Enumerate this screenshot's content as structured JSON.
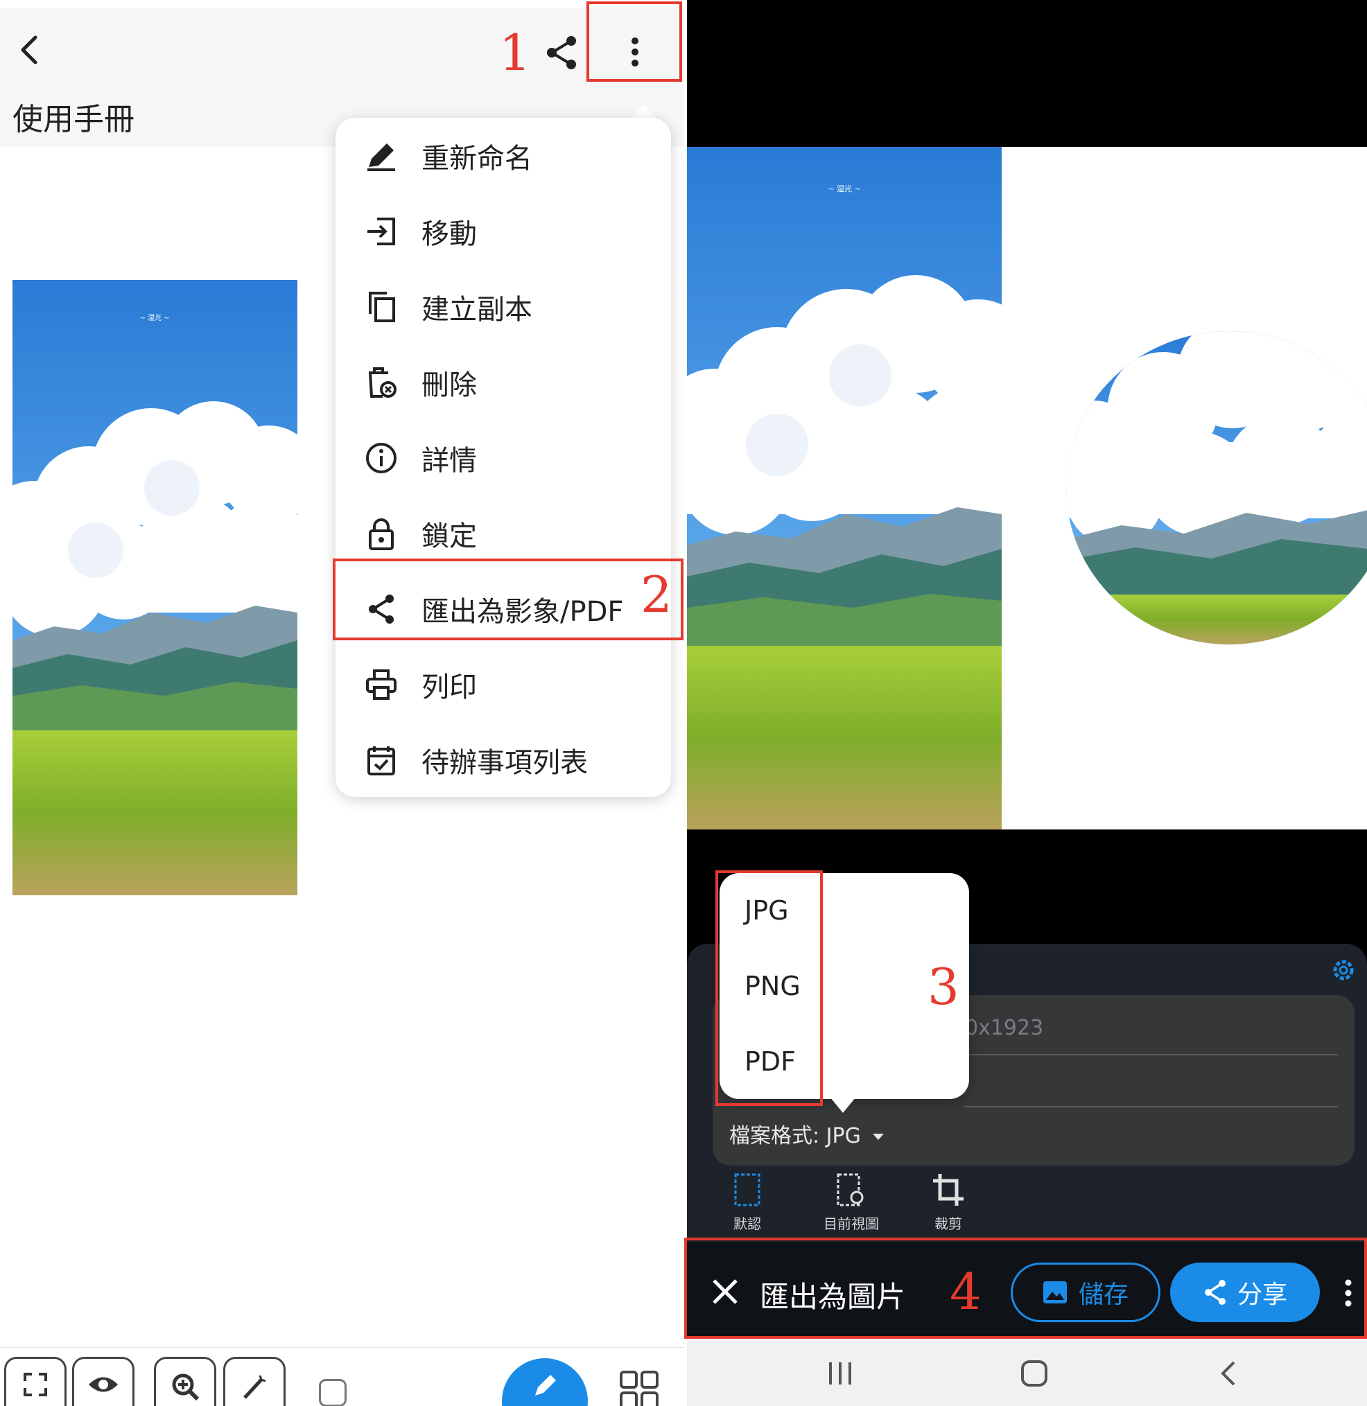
{
  "left_screen": {
    "doc_title": "使用手冊",
    "image_caption": "~ 湿光 ~",
    "menu_items": [
      {
        "label": "重新命名",
        "icon": "rename-pen-icon"
      },
      {
        "label": "移動",
        "icon": "move-arrow-icon"
      },
      {
        "label": "建立副本",
        "icon": "copy-icon"
      },
      {
        "label": "刪除",
        "icon": "delete-icon"
      },
      {
        "label": "詳情",
        "icon": "info-icon"
      },
      {
        "label": "鎖定",
        "icon": "lock-icon"
      },
      {
        "label": "匯出為影象/PDF",
        "icon": "share-icon"
      },
      {
        "label": "列印",
        "icon": "printer-icon"
      },
      {
        "label": "待辦事項列表",
        "icon": "checklist-icon"
      }
    ]
  },
  "right_screen": {
    "image_caption": "~ 湿光 ~",
    "resolution_text": "0x1923",
    "file_format_label": "檔案格式: JPG",
    "format_options": [
      "JPG",
      "PNG",
      "PDF"
    ],
    "modes": [
      {
        "label": "默認",
        "icon": "default-frame-icon"
      },
      {
        "label": "目前視圖",
        "icon": "current-view-icon"
      },
      {
        "label": "裁剪",
        "icon": "crop-icon"
      }
    ],
    "action_title": "匯出為圖片",
    "save_label": "儲存",
    "share_label": "分享"
  },
  "annotations": {
    "step1": "1",
    "step2": "2",
    "step3": "3",
    "step4": "4"
  },
  "colors": {
    "highlight_red": "#e53a2e",
    "accent_blue": "#1a8ce8",
    "sheet_dark": "#1e232b"
  }
}
